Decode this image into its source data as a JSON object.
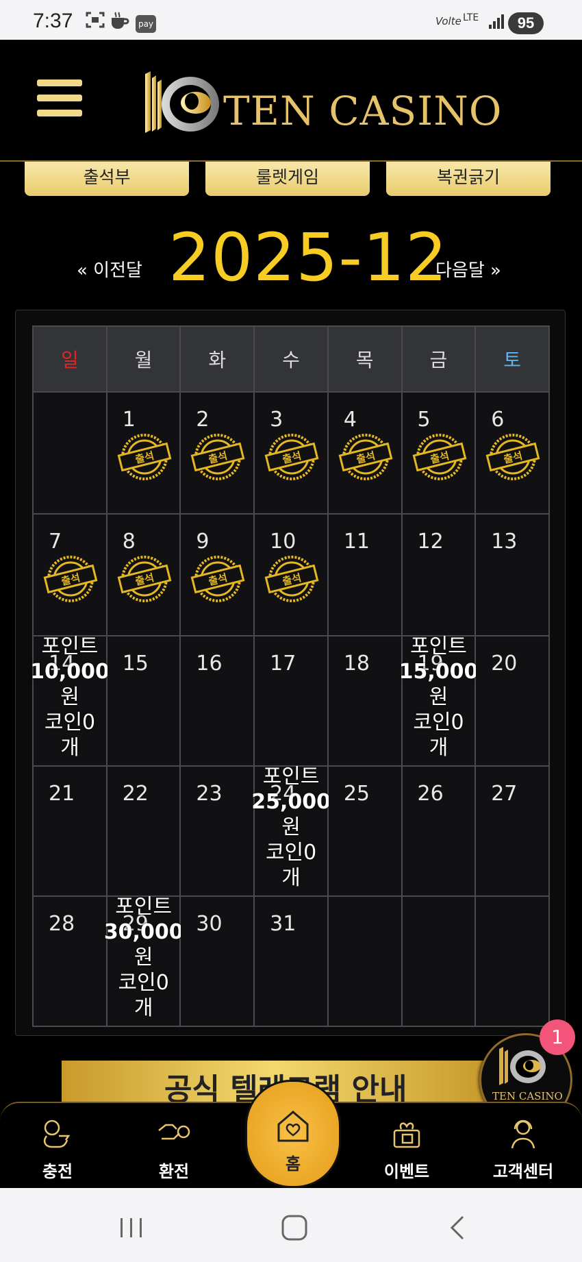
{
  "status_bar": {
    "time": "7:37",
    "network": "Volte",
    "lte": "LTE",
    "battery": "95",
    "pay_label": "pay",
    "icons": [
      "screenshot-icon",
      "coffee-icon",
      "pay-icon",
      "signal-icon",
      "battery-icon"
    ]
  },
  "header": {
    "logo_text": "TEN CASINO"
  },
  "tabs": [
    "출석부",
    "룰렛게임",
    "복권긁기"
  ],
  "month_nav": {
    "prev": "« 이전달",
    "current": "2025-12",
    "next": "다음달 »"
  },
  "calendar": {
    "weekdays": [
      "일",
      "월",
      "화",
      "수",
      "목",
      "금",
      "토"
    ],
    "weekday_colors": {
      "sunday": "#e52424",
      "saturday": "#5db6ee"
    },
    "attendance_label": "출석",
    "weeks": [
      [
        {
          "day": ""
        },
        {
          "day": "1",
          "stamp": true
        },
        {
          "day": "2",
          "stamp": true
        },
        {
          "day": "3",
          "stamp": true
        },
        {
          "day": "4",
          "stamp": true
        },
        {
          "day": "5",
          "stamp": true
        },
        {
          "day": "6",
          "stamp": true
        }
      ],
      [
        {
          "day": "7",
          "stamp": true
        },
        {
          "day": "8",
          "stamp": true
        },
        {
          "day": "9",
          "stamp": true
        },
        {
          "day": "10",
          "stamp": true
        },
        {
          "day": "11"
        },
        {
          "day": "12"
        },
        {
          "day": "13"
        }
      ],
      [
        {
          "day": "14",
          "reward": {
            "label": "포인트",
            "amount": "10,000",
            "unit": "원",
            "coin": "코인0",
            "coin_unit": "개"
          }
        },
        {
          "day": "15"
        },
        {
          "day": "16"
        },
        {
          "day": "17"
        },
        {
          "day": "18"
        },
        {
          "day": "19",
          "reward": {
            "label": "포인트",
            "amount": "15,000",
            "unit": "원",
            "coin": "코인0",
            "coin_unit": "개"
          }
        },
        {
          "day": "20"
        }
      ],
      [
        {
          "day": "21"
        },
        {
          "day": "22"
        },
        {
          "day": "23"
        },
        {
          "day": "24",
          "reward": {
            "label": "포인트",
            "amount": "25,000",
            "unit": "원",
            "coin": "코인0",
            "coin_unit": "개"
          }
        },
        {
          "day": "25"
        },
        {
          "day": "26"
        },
        {
          "day": "27"
        }
      ],
      [
        {
          "day": "28"
        },
        {
          "day": "29",
          "reward": {
            "label": "포인트",
            "amount": "30,000",
            "unit": "원",
            "coin": "코인0",
            "coin_unit": "개"
          }
        },
        {
          "day": "30"
        },
        {
          "day": "31"
        },
        {
          "day": ""
        },
        {
          "day": ""
        },
        {
          "day": ""
        }
      ]
    ]
  },
  "floating": {
    "logo_text": "TEN CASINO",
    "badge": "1"
  },
  "banner": {
    "text": "공식 텔레그램 안내"
  },
  "bottom_nav": [
    {
      "label": "충전",
      "icon": "charge-icon"
    },
    {
      "label": "환전",
      "icon": "exchange-icon"
    },
    {
      "label": "홈",
      "icon": "home-heart-icon"
    },
    {
      "label": "이벤트",
      "icon": "gift-icon"
    },
    {
      "label": "고객센터",
      "icon": "support-icon"
    }
  ],
  "colors": {
    "gold": "#f7cd23",
    "tab_gold": "#e9cb6d",
    "background": "#000000",
    "badge": "#f2547a"
  }
}
